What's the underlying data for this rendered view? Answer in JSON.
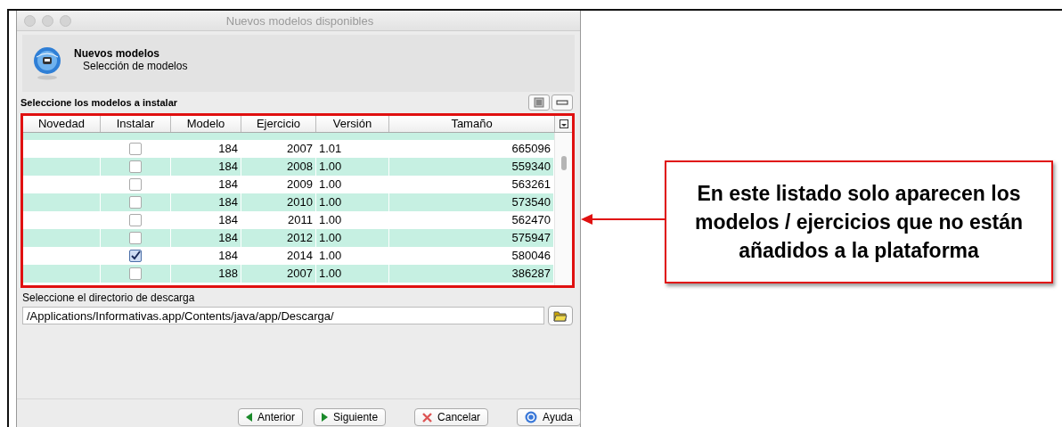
{
  "window": {
    "title": "Nuevos modelos disponibles"
  },
  "header": {
    "title": "Nuevos modelos",
    "subtitle": "Selección de modelos"
  },
  "table_section": {
    "label": "Seleccione los modelos a instalar"
  },
  "table": {
    "columns": [
      "Novedad",
      "Instalar",
      "Modelo",
      "Ejercicio",
      "Versión",
      "Tamaño"
    ],
    "rows": [
      {
        "checked": false,
        "modelo": "184",
        "ejercicio": "2007",
        "version": "1.01",
        "tamano": "665096"
      },
      {
        "checked": false,
        "modelo": "184",
        "ejercicio": "2008",
        "version": "1.00",
        "tamano": "559340"
      },
      {
        "checked": false,
        "modelo": "184",
        "ejercicio": "2009",
        "version": "1.00",
        "tamano": "563261"
      },
      {
        "checked": false,
        "modelo": "184",
        "ejercicio": "2010",
        "version": "1.00",
        "tamano": "573540"
      },
      {
        "checked": false,
        "modelo": "184",
        "ejercicio": "2011",
        "version": "1.00",
        "tamano": "562470"
      },
      {
        "checked": false,
        "modelo": "184",
        "ejercicio": "2012",
        "version": "1.00",
        "tamano": "575947"
      },
      {
        "checked": true,
        "modelo": "184",
        "ejercicio": "2014",
        "version": "1.00",
        "tamano": "580046"
      },
      {
        "checked": false,
        "modelo": "188",
        "ejercicio": "2007",
        "version": "1.00",
        "tamano": "386287"
      }
    ]
  },
  "directory": {
    "label": "Seleccione el directorio de descarga",
    "value": "/Applications/Informativas.app/Contents/java/app/Descarga/"
  },
  "buttons": [
    {
      "kind": "back",
      "label": "Anterior"
    },
    {
      "kind": "next",
      "label": "Siguiente"
    },
    {
      "kind": "cancel",
      "label": "Cancelar"
    },
    {
      "kind": "help",
      "label": "Ayuda"
    }
  ],
  "callout": {
    "text": "En este listado solo aparecen los modelos / ejercicios que no están añadidos a la plataforma"
  }
}
